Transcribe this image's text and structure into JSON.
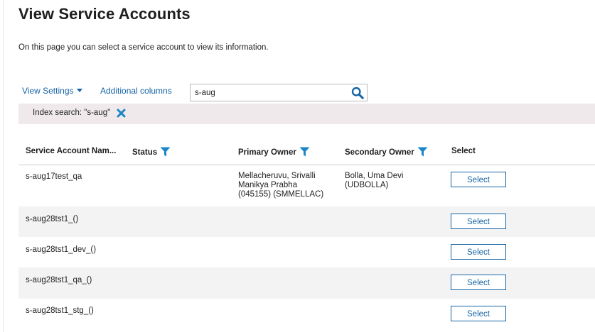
{
  "page": {
    "title": "View Service Accounts",
    "description": "On this page you can select a service account to view its information."
  },
  "toolbar": {
    "view_settings_label": "View Settings",
    "additional_columns_label": "Additional columns"
  },
  "search": {
    "value": "s-aug",
    "icon": "search-icon"
  },
  "index_search": {
    "text": "Index search: \"s-aug\"",
    "clear_icon": "close-icon"
  },
  "table": {
    "columns": [
      {
        "label": "Service Account Nam...",
        "filter": false
      },
      {
        "label": "Status",
        "filter": true
      },
      {
        "label": "Primary Owner",
        "filter": true
      },
      {
        "label": "Secondary Owner",
        "filter": true
      },
      {
        "label": "Select",
        "filter": false
      }
    ],
    "rows": [
      {
        "name": "s-aug17test_qa",
        "status": "",
        "primary_owner": [
          "Mellacheruvu, Srivalli",
          "Manikya Prabha",
          "(045155) (SMMELLAC)"
        ],
        "secondary_owner": [
          "Bolla, Uma Devi",
          "(UDBOLLA)"
        ],
        "select_label": "Select"
      },
      {
        "name": "s-aug28tst1_()",
        "status": "",
        "primary_owner": [],
        "secondary_owner": [],
        "select_label": "Select"
      },
      {
        "name": "s-aug28tst1_dev_()",
        "status": "",
        "primary_owner": [],
        "secondary_owner": [],
        "select_label": "Select"
      },
      {
        "name": "s-aug28tst1_qa_()",
        "status": "",
        "primary_owner": [],
        "secondary_owner": [],
        "select_label": "Select"
      },
      {
        "name": "s-aug28tst1_stg_()",
        "status": "",
        "primary_owner": [],
        "secondary_owner": [],
        "select_label": "Select"
      }
    ]
  },
  "colors": {
    "link": "#1565a6",
    "filter_icon": "#1a86c8",
    "index_bar": "#efe9ec",
    "alt_row": "#f3f3f3"
  }
}
